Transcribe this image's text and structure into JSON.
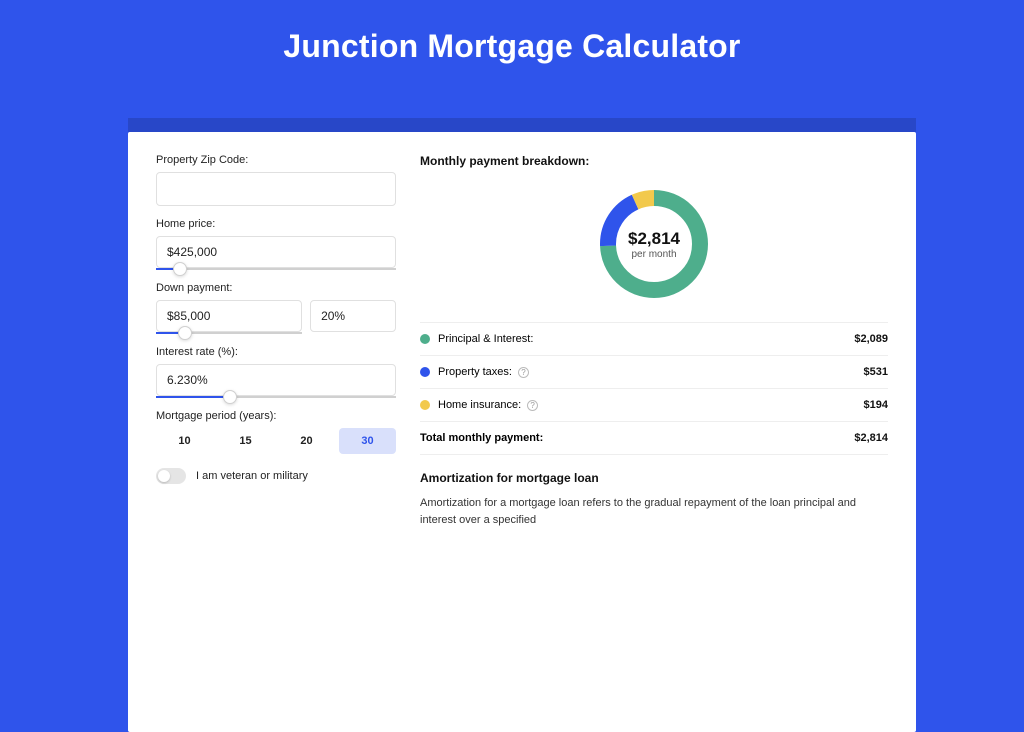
{
  "page_title": "Junction Mortgage Calculator",
  "form": {
    "zip_label": "Property Zip Code:",
    "zip_value": "",
    "home_price_label": "Home price:",
    "home_price_value": "$425,000",
    "home_price_slider_pct": 10,
    "down_payment_label": "Down payment:",
    "down_payment_amount": "$85,000",
    "down_payment_pct": "20%",
    "down_payment_slider_pct": 20,
    "interest_label": "Interest rate (%):",
    "interest_value": "6.230%",
    "interest_slider_pct": 31,
    "period_label": "Mortgage period (years):",
    "period_options": [
      "10",
      "15",
      "20",
      "30"
    ],
    "period_selected": "30",
    "veteran_label": "I am veteran or military",
    "veteran_on": false
  },
  "breakdown": {
    "title": "Monthly payment breakdown:",
    "center_amount": "$2,814",
    "center_sub": "per month",
    "items": [
      {
        "label": "Principal & Interest:",
        "value": "$2,089",
        "color": "#4eae8c",
        "info": false
      },
      {
        "label": "Property taxes:",
        "value": "$531",
        "color": "#2f54eb",
        "info": true
      },
      {
        "label": "Home insurance:",
        "value": "$194",
        "color": "#f2c94c",
        "info": true
      }
    ],
    "total_label": "Total monthly payment:",
    "total_value": "$2,814"
  },
  "chart_data": {
    "type": "pie",
    "title": "Monthly payment breakdown",
    "series": [
      {
        "name": "Principal & Interest",
        "value": 2089,
        "color": "#4eae8c"
      },
      {
        "name": "Property taxes",
        "value": 531,
        "color": "#2f54eb"
      },
      {
        "name": "Home insurance",
        "value": 194,
        "color": "#f2c94c"
      }
    ],
    "total": 2814,
    "unit": "USD per month"
  },
  "amortization": {
    "title": "Amortization for mortgage loan",
    "body": "Amortization for a mortgage loan refers to the gradual repayment of the loan principal and interest over a specified"
  }
}
